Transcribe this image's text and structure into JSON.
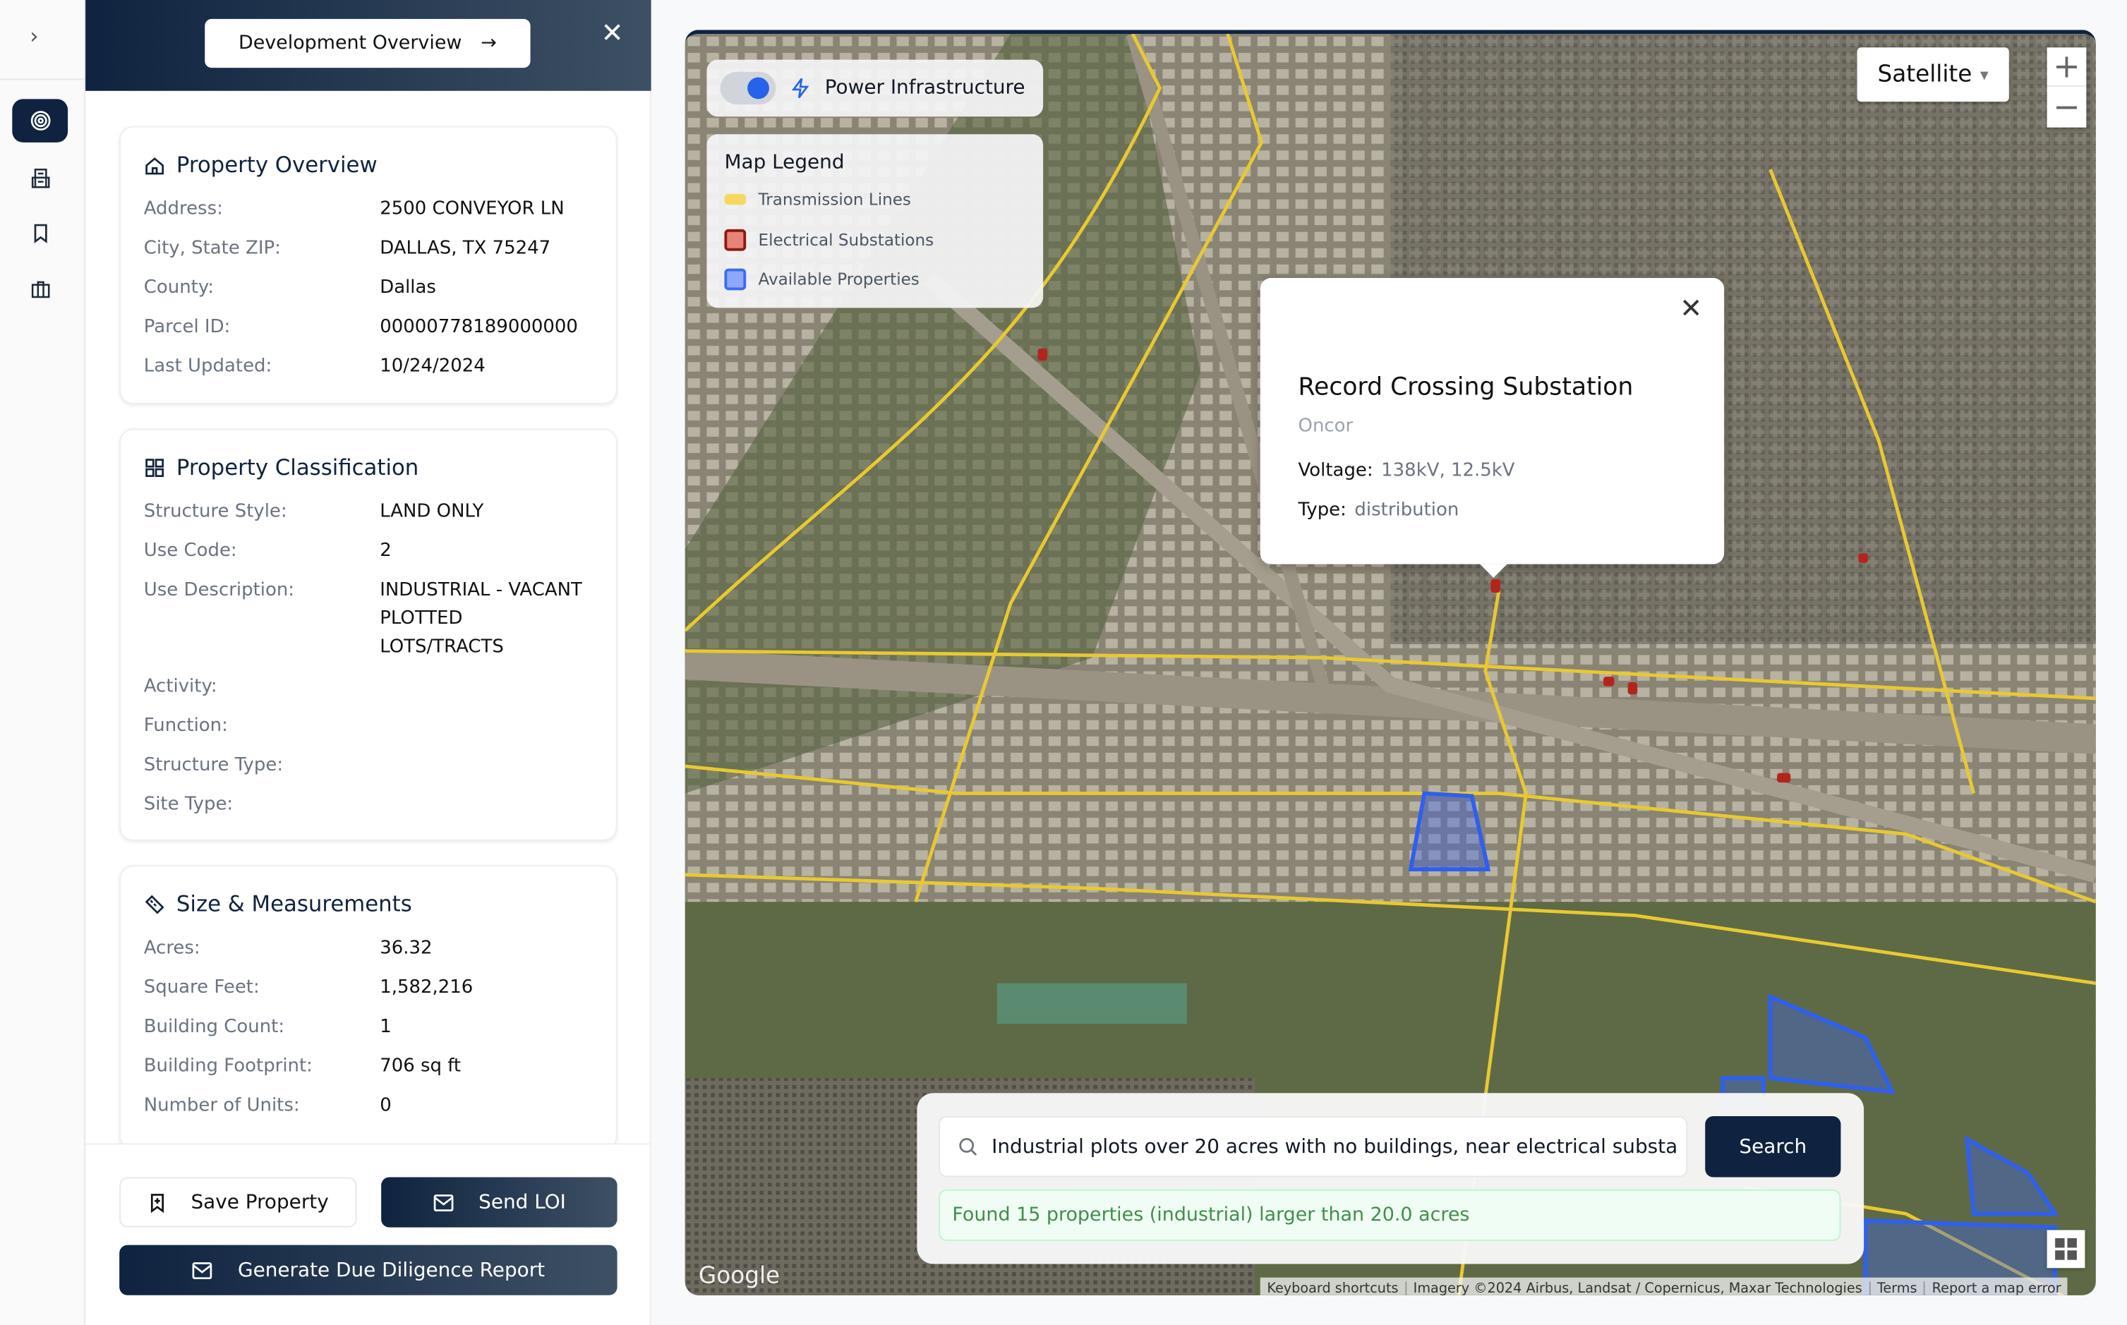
{
  "rail": {
    "icons": [
      "chevron-right-icon",
      "target-icon",
      "building-icon",
      "bookmark-icon",
      "briefcase-icon"
    ],
    "active": "target-icon"
  },
  "panel": {
    "header_button": "Development Overview",
    "sections": [
      {
        "title": "Property Overview",
        "icon": "home-icon",
        "rows": [
          {
            "label": "Address:",
            "value": "2500 CONVEYOR LN"
          },
          {
            "label": "City, State ZIP:",
            "value": "DALLAS, TX 75247"
          },
          {
            "label": "County:",
            "value": "Dallas"
          },
          {
            "label": "Parcel ID:",
            "value": "00000778189000000"
          },
          {
            "label": "Last Updated:",
            "value": "10/24/2024"
          }
        ]
      },
      {
        "title": "Property Classification",
        "icon": "grid-icon",
        "rows": [
          {
            "label": "Structure Style:",
            "value": "LAND ONLY"
          },
          {
            "label": "Use Code:",
            "value": "2"
          },
          {
            "label": "Use Description:",
            "value": "INDUSTRIAL - VACANT PLOTTED LOTS/TRACTS"
          },
          {
            "label": "Activity:",
            "value": ""
          },
          {
            "label": "Function:",
            "value": ""
          },
          {
            "label": "Structure Type:",
            "value": ""
          },
          {
            "label": "Site Type:",
            "value": ""
          }
        ]
      },
      {
        "title": "Size & Measurements",
        "icon": "ruler-icon",
        "rows": [
          {
            "label": "Acres:",
            "value": "36.32"
          },
          {
            "label": "Square Feet:",
            "value": "1,582,216"
          },
          {
            "label": "Building Count:",
            "value": "1"
          },
          {
            "label": "Building Footprint:",
            "value": "706 sq ft"
          },
          {
            "label": "Number of Units:",
            "value": "0"
          }
        ]
      }
    ],
    "buttons": {
      "save": "Save Property",
      "loi": "Send LOI",
      "report": "Generate Due Diligence Report"
    }
  },
  "map": {
    "toggle": {
      "label": "Power Infrastructure",
      "on": true
    },
    "legend": {
      "title": "Map Legend",
      "items": [
        {
          "label": "Transmission Lines",
          "color": "#f6d860"
        },
        {
          "label": "Electrical Substations",
          "color": "#e88379"
        },
        {
          "label": "Available Properties",
          "color": "#8fa8f5"
        }
      ]
    },
    "popup": {
      "name": "Record Crossing Substation",
      "operator": "Oncor",
      "voltage_label": "Voltage:",
      "voltage": "138kV, 12.5kV",
      "type_label": "Type:",
      "type": "distribution"
    },
    "map_type": "Satellite",
    "zoom_in": "+",
    "zoom_out": "−",
    "search": {
      "query": "Industrial plots over 20 acres with no buildings, near electrical substa",
      "button": "Search",
      "result": "Found 15 properties (industrial) larger than 20.0 acres"
    },
    "google": "Google",
    "attribution": [
      "Keyboard shortcuts",
      "Imagery ©2024 Airbus, Landsat / Copernicus, Maxar Technologies",
      "Terms",
      "Report a map error"
    ]
  },
  "colors": {
    "navy": "#0f2340",
    "accent": "#2563eb",
    "line": "#e8c930",
    "success": "#3f8f4a"
  }
}
